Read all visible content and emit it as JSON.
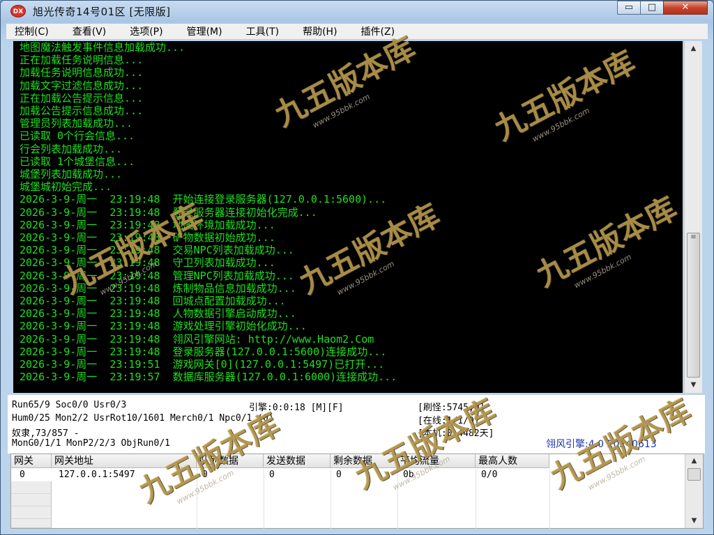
{
  "window": {
    "icon_text": "DX",
    "title": "旭光传奇14号01区 [无限版]",
    "min_glyph": "▭",
    "max_glyph": "□",
    "close_glyph": "✕"
  },
  "menu": [
    {
      "label": "控制(C)"
    },
    {
      "label": "查看(V)"
    },
    {
      "label": "选项(P)"
    },
    {
      "label": "管理(M)"
    },
    {
      "label": "工具(T)"
    },
    {
      "label": "帮助(H)"
    },
    {
      "label": "插件(Z)"
    }
  ],
  "log": [
    "地图魔法触发事件信息加载成功...",
    "正在加载任务说明信息...",
    "加载任务说明信息成功...",
    "加载文字过滤信息成功...",
    "正在加载公告提示信息...",
    "加载公告提示信息成功...",
    "管理员列表加载成功...",
    "已读取 0个行会信息...",
    "行会列表加载成功...",
    "已读取 1个城堡信息...",
    "城堡列表加载成功...",
    "城堡城初始完成...",
    "2026-3-9-周一  23:19:48  开始连接登录服务器(127.0.0.1:5600)...",
    "2026-3-9-周一  23:19:48  登录服务器连接初始化完成...",
    "2026-3-9-周一  23:19:48  地图环境加载成功...",
    "2026-3-9-周一  23:19:48  矿物数据初始成功...",
    "2026-3-9-周一  23:19:48  交易NPC列表加载成功...",
    "2026-3-9-周一  23:19:48  守卫列表加载成功...",
    "2026-3-9-周一  23:19:48  管理NPC列表加载成功...",
    "2026-3-9-周一  23:19:48  炼制物品信息加载成功...",
    "2026-3-9-周一  23:19:48  回城点配置加载成功...",
    "2026-3-9-周一  23:19:48  人物数据引擎启动成功...",
    "2026-3-9-周一  23:19:48  游戏处理引擎初始化成功...",
    "2026-3-9-周一  23:19:48  翎风引擎网站: http://www.Haom2.Com",
    "2026-3-9-周一  23:19:48  登录服务器(127.0.0.1:5600)连接成功...",
    "2026-3-9-周一  23:19:51  游戏网关[0](127.0.0.1:5497)已打开...",
    "2026-3-9-周一  23:19:57  数据库服务器(127.0.0.1:6000)连接成功..."
  ],
  "scroll": {
    "up": "▲",
    "down": "▼",
    "grip": "≡"
  },
  "status": {
    "run": "Run65/9 Soc0/0 Usr0/3",
    "engine_time": "引擎:0:0:18 [M][F]",
    "refresh": "[刷怪:5745;0]",
    "hum": "Hum0/25 Mon2/2 UsrRot10/1601 Merch0/1 Npc0/1 (0)",
    "online": "[在线:1/1/0]",
    "slave": "奴隶,73/857 -",
    "machine": "[本机:0.4482天]",
    "mon": "MonG0/1/1 MonP2/2/3 ObjRun0/1",
    "engine_version": "翎风引擎:4.0 20240613"
  },
  "gate_table": {
    "headers": [
      "网关",
      "网关地址",
      "队列数据",
      "发送数据",
      "剩余数据",
      "平均流量",
      "最高人数"
    ],
    "rows": [
      [
        "0",
        "127.0.0.1:5497",
        "0",
        "0",
        "0",
        "0b",
        "0/0"
      ]
    ]
  },
  "watermark": {
    "text": "九五版本库",
    "sub": "www.95bbk.com"
  },
  "colors": {
    "console_bg": "#000000",
    "console_text": "#1ee01e",
    "engine_version": "#1a34a8"
  }
}
